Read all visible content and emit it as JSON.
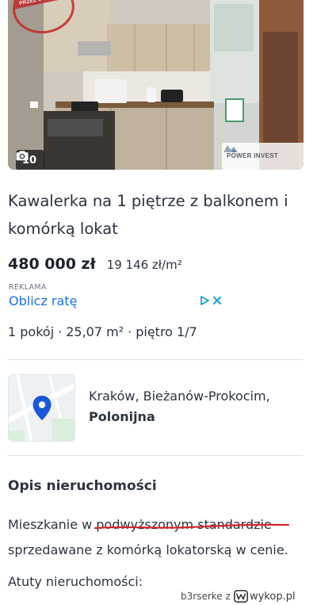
{
  "listing": {
    "badge": "POLECANE PRZEZ BIURO",
    "photo_count": "10",
    "watermark": "POWER INVEST",
    "title": "Kawalerka na 1 piętrze z balkonem i komórką lokat",
    "price": "480 000 zł",
    "price_per_sqm": "19 146 zł/m²",
    "rooms": "1 pokój",
    "area": "25,07 m²",
    "floor": "piętro 1/7",
    "location_line1": "Kraków, Bieżanów-Prokocim,",
    "location_line2": "Polonijna"
  },
  "ad": {
    "label": "REKLAMA",
    "link": "Oblicz ratę"
  },
  "description": {
    "heading": "Opis nieruchomości",
    "text": "Mieszkanie w podwyższonym standardzie sprzedawane z komórką lokatorską w cenie.",
    "next_heading": "Atuty nieruchomości:"
  },
  "footer_watermark": {
    "user": "b3rserke",
    "connector": "z",
    "site": "wykop.pl"
  },
  "colors": {
    "link": "#1a73e8",
    "text": "#2b3440",
    "map_pin": "#1a57d6",
    "underline": "#d6262a",
    "badge": "#c0272d"
  }
}
